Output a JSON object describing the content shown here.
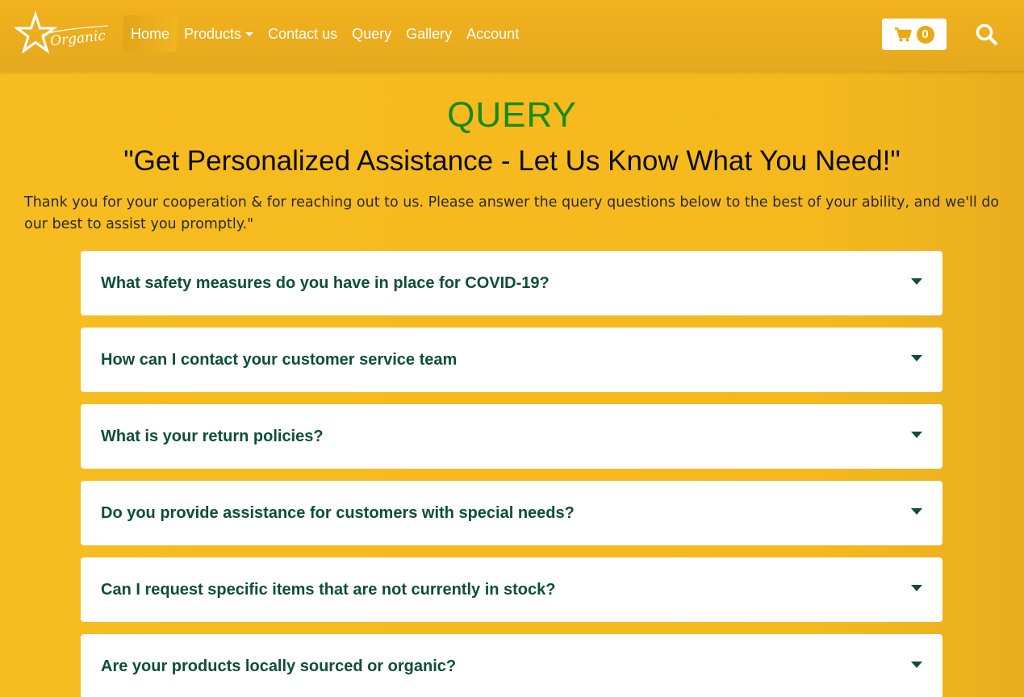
{
  "brand": {
    "logo_text": "Organic",
    "icon": "star-logo-icon"
  },
  "nav": {
    "items": [
      {
        "label": "Home",
        "active": true
      },
      {
        "label": "Products",
        "dropdown": true
      },
      {
        "label": "Contact us"
      },
      {
        "label": "Query"
      },
      {
        "label": "Gallery"
      },
      {
        "label": "Account"
      }
    ],
    "cart": {
      "count": "0",
      "icon": "cart-icon"
    },
    "search": {
      "icon": "search-icon"
    }
  },
  "main": {
    "title": "QUERY",
    "subtitle": "\"Get Personalized Assistance - Let Us Know What You Need!\"",
    "intro": "Thank you for your cooperation & for reaching out to us. Please answer the query questions below to the best of your ability, and we'll do our best to assist you promptly.\"",
    "faq": [
      {
        "question": "What safety measures do you have in place for COVID-19?"
      },
      {
        "question": "How can I contact your customer service team"
      },
      {
        "question": "What is your return policies?"
      },
      {
        "question": "Do you provide assistance for customers with special needs?"
      },
      {
        "question": "Can I request specific items that are not currently in stock?"
      },
      {
        "question": "Are your products locally sourced or organic?"
      }
    ]
  },
  "colors": {
    "page_bg": "#f7bc1f",
    "title_green": "#178a14",
    "question_green": "#0d4f35",
    "badge": "#e8a913"
  }
}
